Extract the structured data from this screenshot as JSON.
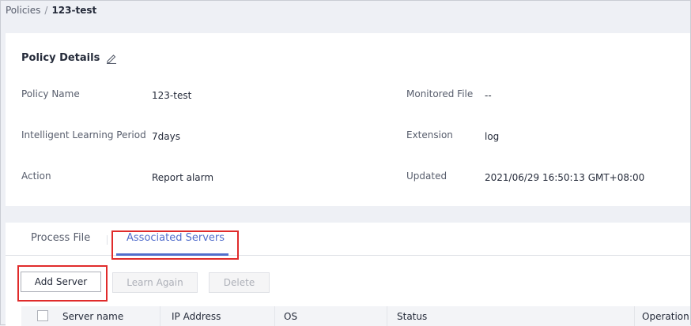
{
  "breadcrumb": {
    "parent": "Policies",
    "separator": "/",
    "current": "123-test"
  },
  "details": {
    "title": "Policy Details",
    "fields": {
      "policy_name": {
        "label": "Policy Name",
        "value": "123-test"
      },
      "learning_period": {
        "label": "Intelligent Learning Period",
        "value": "7days"
      },
      "action": {
        "label": "Action",
        "value": "Report alarm"
      },
      "monitored_file": {
        "label": "Monitored File",
        "value": "--"
      },
      "extension": {
        "label": "Extension",
        "value": "log"
      },
      "updated": {
        "label": "Updated",
        "value": "2021/06/29 16:50:13 GMT+08:00"
      }
    }
  },
  "tabs": [
    {
      "label": "Process File",
      "active": false
    },
    {
      "label": "Associated Servers",
      "active": true
    }
  ],
  "toolbar": {
    "add_server": "Add Server",
    "learn_again": "Learn Again",
    "delete": "Delete"
  },
  "table": {
    "columns": [
      "Server name",
      "IP Address",
      "OS",
      "Status",
      "Operation"
    ]
  },
  "colors": {
    "accent": "#526ecc",
    "highlight": "#e02b2b"
  }
}
